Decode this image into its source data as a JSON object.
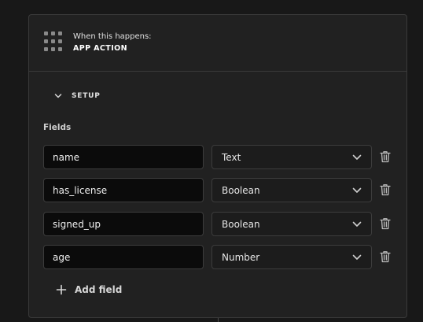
{
  "trigger": {
    "caption": "When this happens:",
    "name": "APP ACTION",
    "icon": "grid-icon"
  },
  "setup": {
    "label": "SETUP",
    "expanded": true
  },
  "fields_section": {
    "label": "Fields",
    "fields": [
      {
        "name": "name",
        "type": "Text"
      },
      {
        "name": "has_license",
        "type": "Boolean"
      },
      {
        "name": "signed_up",
        "type": "Boolean"
      },
      {
        "name": "age",
        "type": "Number"
      }
    ],
    "add_label": "Add field"
  }
}
